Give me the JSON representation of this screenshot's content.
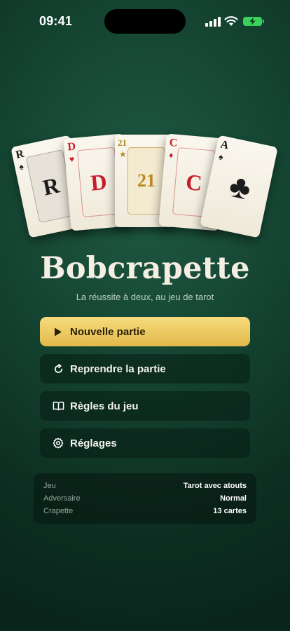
{
  "status": {
    "time": "09:41"
  },
  "cards": [
    {
      "rank": "R",
      "center": "R",
      "suit": "♠",
      "color": "black"
    },
    {
      "rank": "D",
      "center": "D",
      "suit": "♥",
      "color": "red"
    },
    {
      "rank": "21",
      "center": "21",
      "suit": "★",
      "color": "gold"
    },
    {
      "rank": "C",
      "center": "C",
      "suit": "♦",
      "color": "red"
    },
    {
      "rank": "A",
      "center": "♣",
      "suit": "♠",
      "color": "black"
    }
  ],
  "title": "Bobcrapette",
  "subtitle": "La réussite à deux, au jeu de tarot",
  "menu": {
    "new_game": "Nouvelle partie",
    "resume": "Reprendre la partie",
    "rules": "Règles du jeu",
    "settings": "Réglages"
  },
  "info": [
    {
      "key": "Jeu",
      "value": "Tarot avec atouts"
    },
    {
      "key": "Adversaire",
      "value": "Normal"
    },
    {
      "key": "Crapette",
      "value": "13 cartes"
    }
  ],
  "colors": {
    "accent": "#e9c15a",
    "background": "#154532",
    "red_suit": "#c81e2a",
    "gold_trump": "#b78922"
  }
}
